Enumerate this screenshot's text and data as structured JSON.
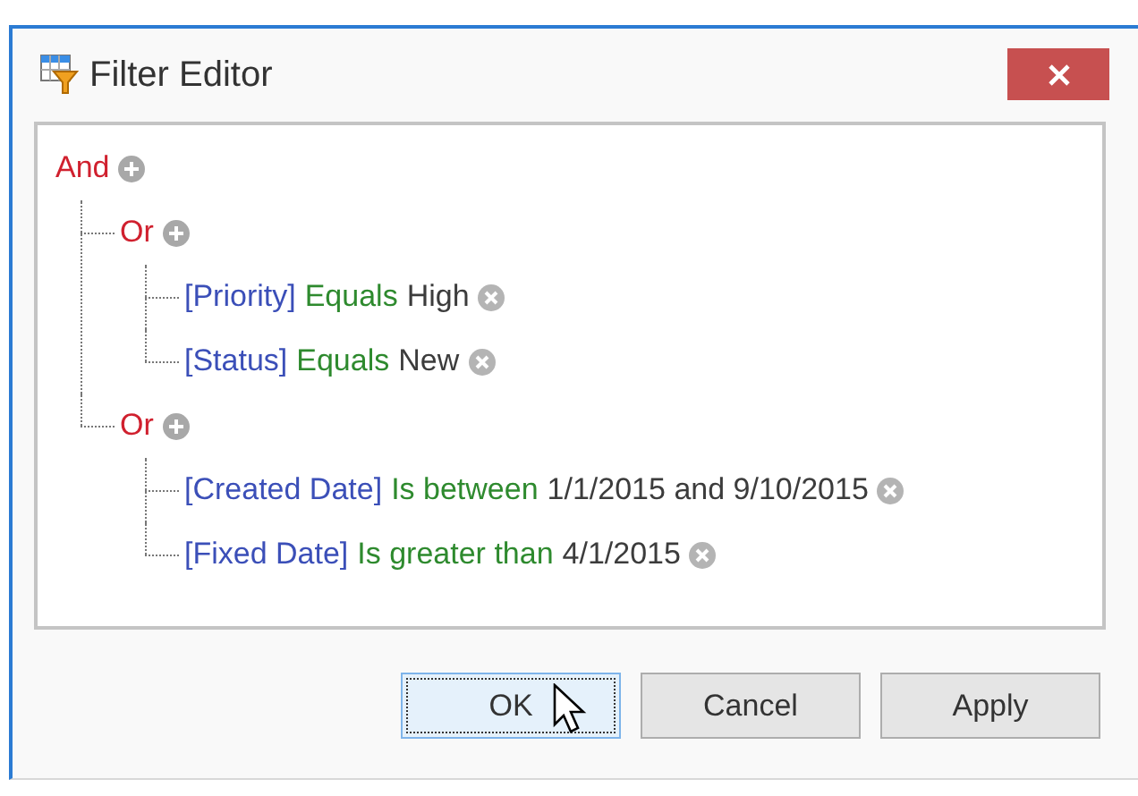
{
  "window": {
    "title": "Filter Editor"
  },
  "tree": {
    "kind": "group",
    "operator": "And",
    "children": [
      {
        "kind": "group",
        "operator": "Or",
        "children": [
          {
            "kind": "condition",
            "field": "[Priority]",
            "operation": "Equals",
            "value": "High"
          },
          {
            "kind": "condition",
            "field": "[Status]",
            "operation": "Equals",
            "value": "New"
          }
        ]
      },
      {
        "kind": "group",
        "operator": "Or",
        "children": [
          {
            "kind": "condition",
            "field": "[Created Date]",
            "operation": "Is between",
            "value": "1/1/2015 and 9/10/2015"
          },
          {
            "kind": "condition",
            "field": "[Fixed Date]",
            "operation": "Is greater than",
            "value": "4/1/2015"
          }
        ]
      }
    ]
  },
  "buttons": [
    {
      "label": "OK",
      "focused": true
    },
    {
      "label": "Cancel",
      "focused": false
    },
    {
      "label": "Apply",
      "focused": false
    }
  ]
}
